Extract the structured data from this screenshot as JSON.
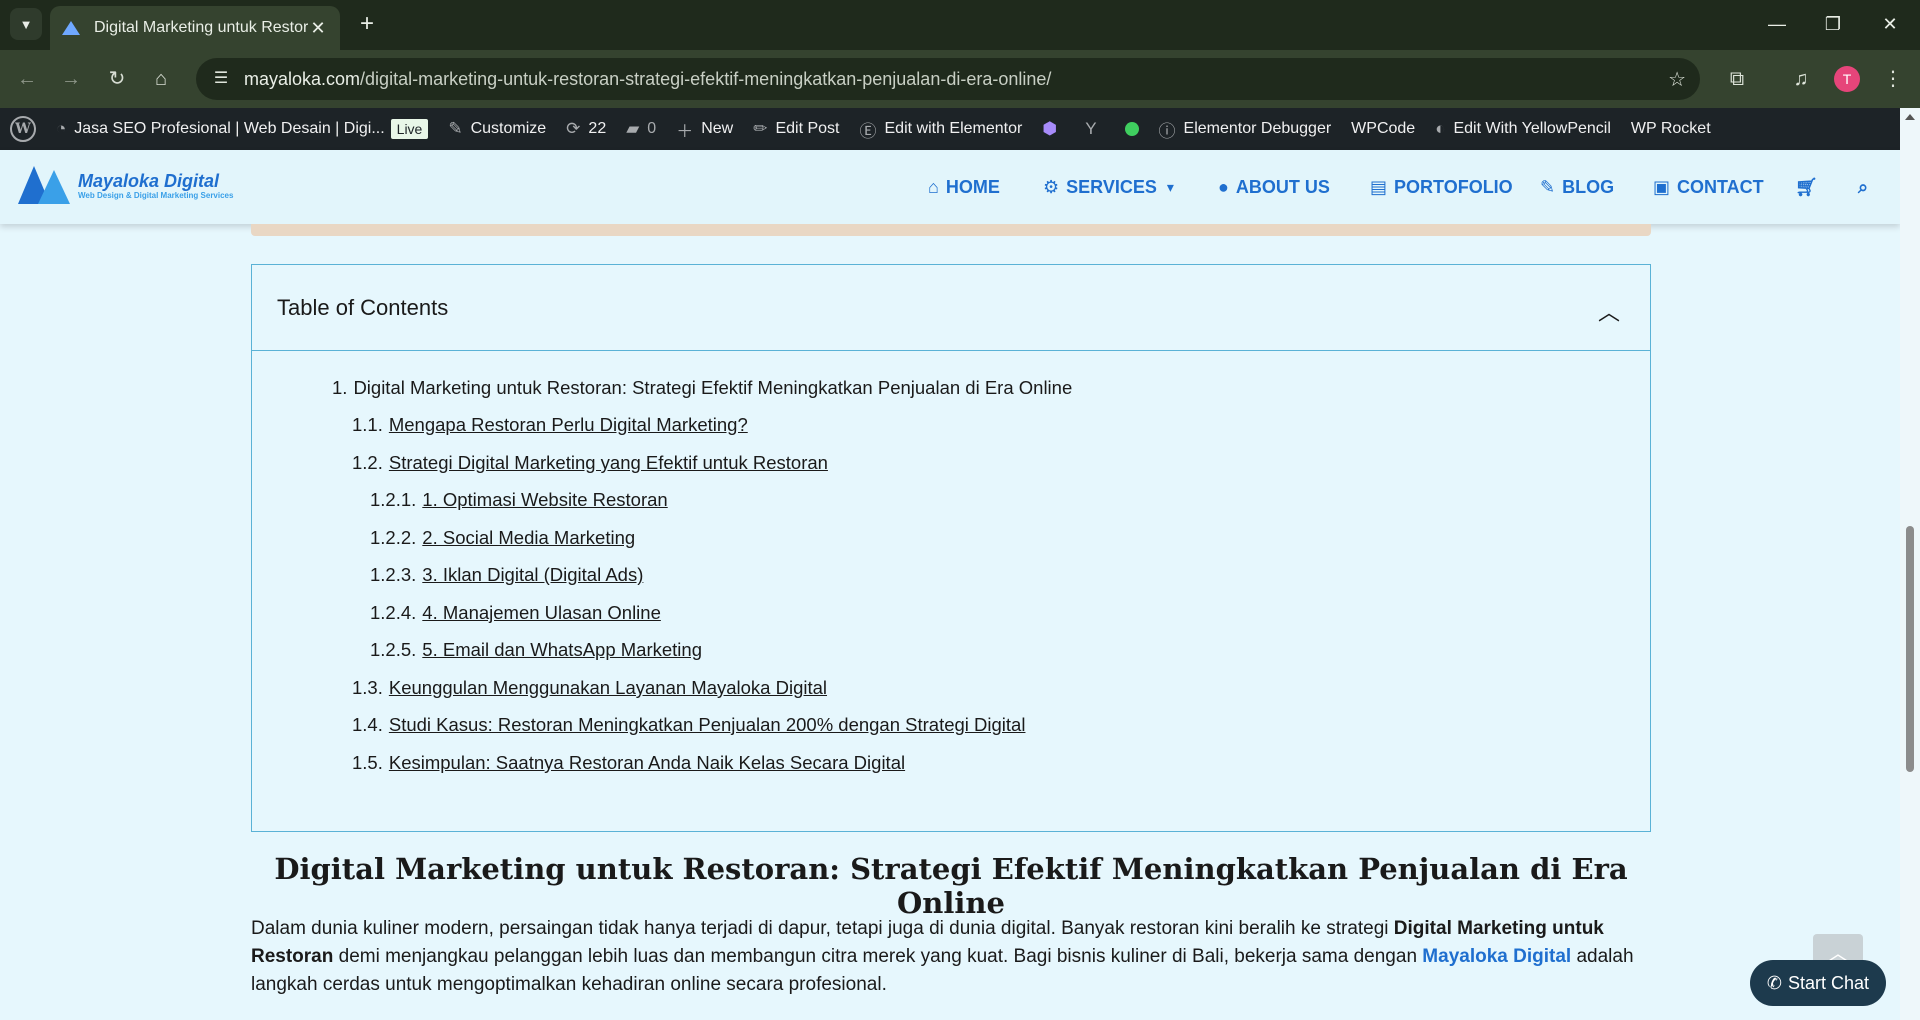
{
  "browser": {
    "tab_title": "Digital Marketing untuk Restoran",
    "tab_close": "✕",
    "new_tab": "+",
    "url_domain": "mayaloka.com",
    "url_path": "/digital-marketing-untuk-restoran-strategi-efektif-meningkatkan-penjualan-di-era-online/",
    "avatar_letter": "T"
  },
  "adminbar": {
    "site_name": "Jasa SEO Profesional | Web Desain | Digi...",
    "live_badge": "Live",
    "customize": "Customize",
    "updates_count": "22",
    "comments_count": "0",
    "new_label": "New",
    "edit_post": "Edit Post",
    "edit_elementor": "Edit with Elementor",
    "elementor_debugger": "Elementor Debugger",
    "wpcode": "WPCode",
    "yellowpencil": "Edit With YellowPencil",
    "wprocket": "WP Rocket"
  },
  "site": {
    "logo_name": "Mayaloka Digital",
    "logo_tagline": "Web Design & Digital Marketing Services",
    "menu": {
      "home": "HOME",
      "services": "SERVICES",
      "about": "ABOUT US",
      "portfolio": "PORTOFOLIO",
      "blog": "BLOG",
      "contact": "CONTACT"
    }
  },
  "toc": {
    "title": "Table of Contents",
    "items": [
      {
        "num": "1.",
        "text": "Digital Marketing untuk Restoran: Strategi Efektif Meningkatkan Penjualan di Era Online"
      },
      {
        "num": "1.1.",
        "text": "Mengapa Restoran Perlu Digital Marketing?"
      },
      {
        "num": "1.2.",
        "text": "Strategi Digital Marketing yang Efektif untuk Restoran"
      },
      {
        "num": "1.2.1.",
        "text": "1. Optimasi Website Restoran"
      },
      {
        "num": "1.2.2.",
        "text": "2. Social Media Marketing"
      },
      {
        "num": "1.2.3.",
        "text": "3. Iklan Digital (Digital Ads)"
      },
      {
        "num": "1.2.4.",
        "text": "4. Manajemen Ulasan Online"
      },
      {
        "num": "1.2.5.",
        "text": "5. Email dan WhatsApp Marketing"
      },
      {
        "num": "1.3.",
        "text": "Keunggulan Menggunakan Layanan Mayaloka Digital"
      },
      {
        "num": "1.4.",
        "text": "Studi Kasus: Restoran Meningkatkan Penjualan 200% dengan Strategi Digital"
      },
      {
        "num": "1.5.",
        "text": "Kesimpulan: Saatnya Restoran Anda Naik Kelas Secara Digital"
      }
    ]
  },
  "article": {
    "title": "Digital Marketing untuk Restoran: Strategi Efektif Meningkatkan Penjualan di Era Online",
    "p1_a": "Dalam dunia kuliner modern, persaingan tidak hanya terjadi di dapur, tetapi juga di dunia digital. Banyak restoran kini beralih ke strategi ",
    "p1_b": "Digital Marketing untuk Restoran",
    "p1_c": " demi menjangkau pelanggan lebih luas dan membangun citra merek yang kuat. Bagi bisnis kuliner di Bali, bekerja sama dengan ",
    "p1_link": "Mayaloka Digital",
    "p1_d": " adalah langkah cerdas untuk mengoptimalkan kehadiran online secara profesional."
  },
  "widgets": {
    "start_chat": "Start Chat"
  }
}
